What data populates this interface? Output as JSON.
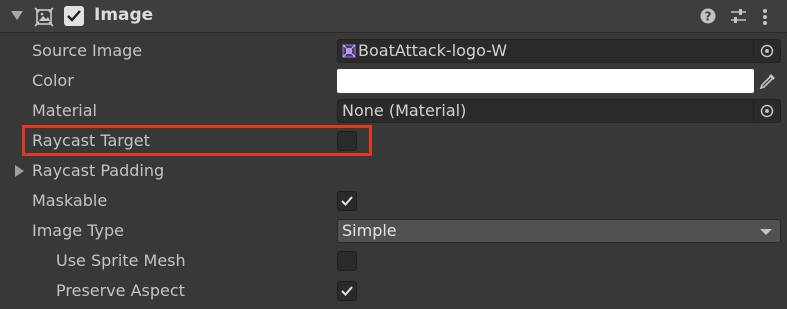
{
  "component": {
    "title": "Image",
    "enabled": true,
    "accent_color": "#e0391d"
  },
  "properties": {
    "source_image": {
      "label": "Source Image",
      "value": "BoatAttack-logo-W"
    },
    "color": {
      "label": "Color",
      "value": "#ffffff"
    },
    "material": {
      "label": "Material",
      "value": "None (Material)"
    },
    "raycast_target": {
      "label": "Raycast Target",
      "checked": false
    },
    "raycast_padding": {
      "label": "Raycast Padding",
      "expanded": false
    },
    "maskable": {
      "label": "Maskable",
      "checked": true
    },
    "image_type": {
      "label": "Image Type",
      "value": "Simple"
    },
    "use_sprite_mesh": {
      "label": "Use Sprite Mesh",
      "checked": false
    },
    "preserve_aspect": {
      "label": "Preserve Aspect",
      "checked": true
    }
  },
  "icons": {
    "fold": "chevron-down-icon",
    "component": "image-component-icon",
    "help": "help-icon",
    "presets": "presets-icon",
    "more": "more-options-icon",
    "object_picker": "object-picker-icon",
    "eyedropper": "eyedropper-icon",
    "sprite": "sprite-icon"
  }
}
